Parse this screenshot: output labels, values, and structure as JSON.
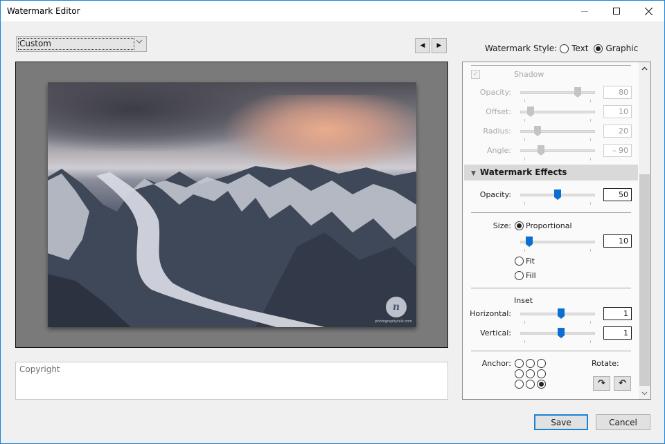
{
  "window": {
    "title": "Watermark Editor",
    "controls": {
      "minimize": "minimize-icon",
      "maximize": "maximize-icon",
      "close": "close-icon"
    }
  },
  "preset": {
    "selected": "Custom",
    "icon": "chevron-down-icon"
  },
  "navigation": {
    "prev_icon": "triangle-left-icon",
    "next_icon": "triangle-right-icon",
    "prev_glyph": "◀",
    "next_glyph": "▶"
  },
  "preview": {
    "watermark_logo_text": "n",
    "watermark_url": "photographytalk.com"
  },
  "copyright_field": {
    "value": "Copyright"
  },
  "watermark_style": {
    "label": "Watermark Style:",
    "options": [
      {
        "label": "Text",
        "selected": false
      },
      {
        "label": "Graphic",
        "selected": true
      }
    ]
  },
  "shadow": {
    "label": "Shadow",
    "checked": true,
    "enabled": false,
    "rows": [
      {
        "label": "Opacity:",
        "value": "80",
        "fraction": 0.8
      },
      {
        "label": "Offset:",
        "value": "10",
        "fraction": 0.1
      },
      {
        "label": "Radius:",
        "value": "20",
        "fraction": 0.2
      },
      {
        "label": "Angle:",
        "value": "– 90",
        "fraction": 0.25
      }
    ]
  },
  "effects": {
    "header": "Watermark Effects",
    "opacity": {
      "label": "Opacity:",
      "value": "50",
      "fraction": 0.5
    },
    "size": {
      "label": "Size:",
      "options": [
        {
          "label": "Proportional",
          "selected": true
        },
        {
          "label": "Fit",
          "selected": false
        },
        {
          "label": "Fill",
          "selected": false
        }
      ],
      "value": "10",
      "fraction": 0.08
    },
    "inset": {
      "label": "Inset",
      "horizontal": {
        "label": "Horizontal:",
        "value": "1",
        "fraction": 0.55
      },
      "vertical": {
        "label": "Vertical:",
        "value": "1",
        "fraction": 0.55
      }
    },
    "anchor": {
      "label": "Anchor:",
      "selected_index": 8
    },
    "rotate": {
      "label": "Rotate:",
      "cw_glyph": "↷",
      "ccw_glyph": "↶"
    }
  },
  "buttons": {
    "save": "Save",
    "cancel": "Cancel"
  },
  "colors": {
    "accent": "#1883d7",
    "slider_thumb_active": "#0a6fd1",
    "slider_thumb_disabled": "#c4c4c4"
  }
}
